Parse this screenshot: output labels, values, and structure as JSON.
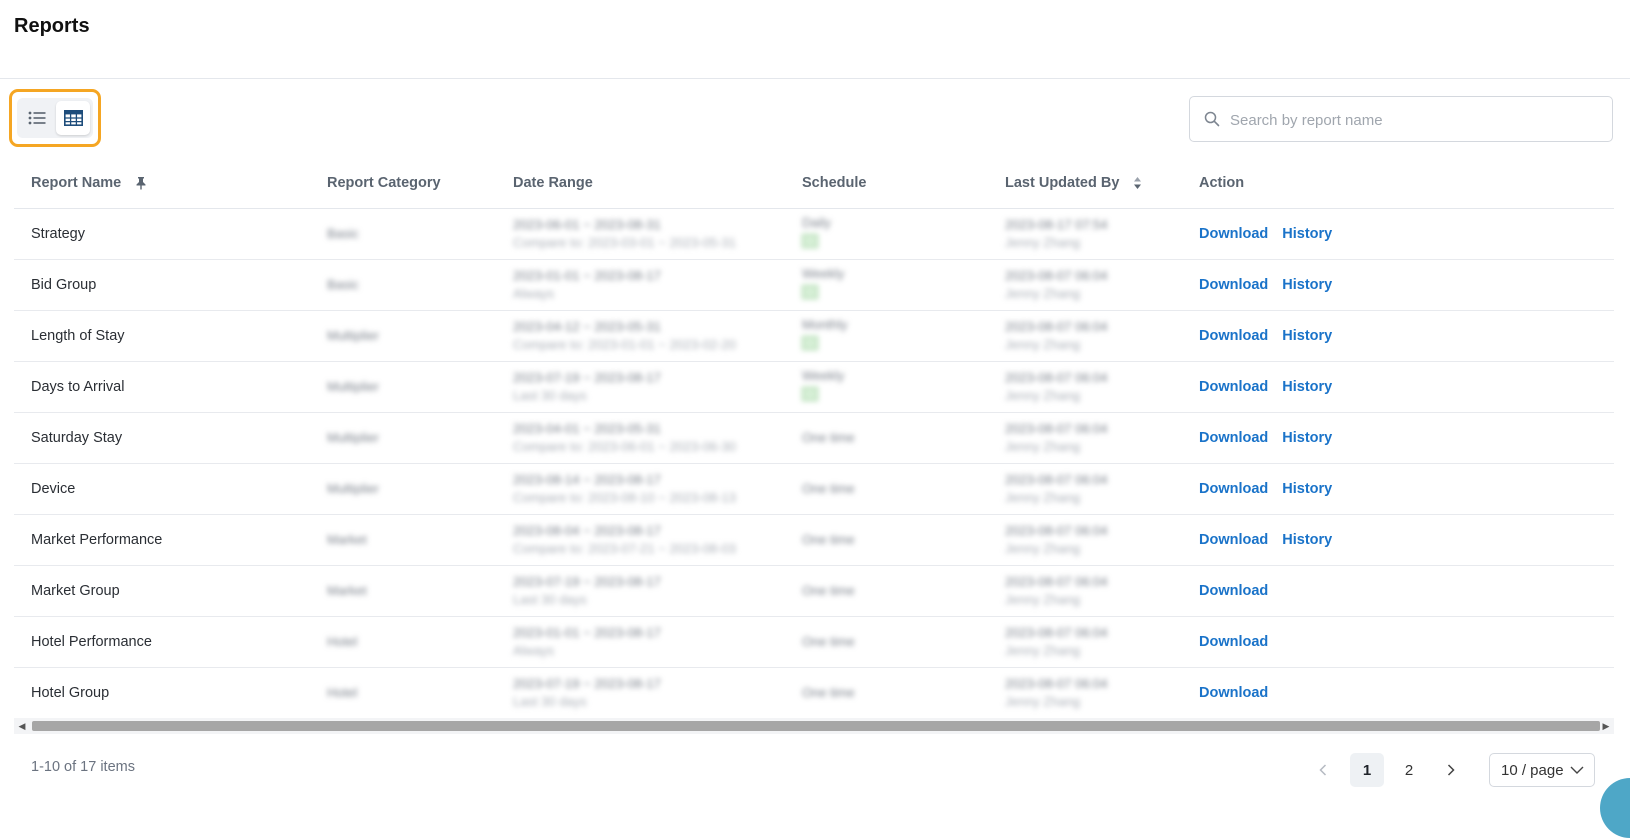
{
  "page": {
    "title": "Reports"
  },
  "view_toggle": {
    "list_icon": "list-icon",
    "table_icon": "table-icon",
    "active": "table"
  },
  "search": {
    "placeholder": "Search by report name",
    "value": "",
    "icon": "search-icon"
  },
  "table": {
    "columns": [
      {
        "label": "Report Name",
        "icon": "pin-icon"
      },
      {
        "label": "Report Category"
      },
      {
        "label": "Date Range"
      },
      {
        "label": "Schedule"
      },
      {
        "label": "Last Updated By",
        "icon": "sort-icon"
      },
      {
        "label": "Action"
      }
    ],
    "rows": [
      {
        "name": "Strategy",
        "category": "Basic",
        "date": "2023-06-01 ~ 2023-08-31",
        "date_sub": "Compare to: 2023-03-01 ~ 2023-05-31",
        "schedule": "Daily",
        "schedule_icon": true,
        "updated": "2023-08-17 07:54",
        "updated_by": "Jenny Zhang",
        "actions": [
          "Download",
          "History"
        ]
      },
      {
        "name": "Bid Group",
        "category": "Basic",
        "date": "2023-01-01 ~ 2023-08-17",
        "date_sub": "Always",
        "schedule": "Weekly",
        "schedule_icon": true,
        "updated": "2023-08-07 06:04",
        "updated_by": "Jenny Zhang",
        "actions": [
          "Download",
          "History"
        ]
      },
      {
        "name": "Length of Stay",
        "category": "Multiplier",
        "date": "2023-04-12 ~ 2023-05-31",
        "date_sub": "Compare to: 2023-01-01 ~ 2023-02-20",
        "schedule": "Monthly",
        "schedule_icon": true,
        "updated": "2023-08-07 06:04",
        "updated_by": "Jenny Zhang",
        "actions": [
          "Download",
          "History"
        ]
      },
      {
        "name": "Days to Arrival",
        "category": "Multiplier",
        "date": "2023-07-19 ~ 2023-08-17",
        "date_sub": "Last 30 days",
        "schedule": "Weekly",
        "schedule_icon": true,
        "updated": "2023-08-07 06:04",
        "updated_by": "Jenny Zhang",
        "actions": [
          "Download",
          "History"
        ]
      },
      {
        "name": "Saturday Stay",
        "category": "Multiplier",
        "date": "2023-04-01 ~ 2023-05-31",
        "date_sub": "Compare to: 2023-06-01 ~ 2023-06-30",
        "schedule": "One time",
        "schedule_icon": false,
        "updated": "2023-08-07 06:04",
        "updated_by": "Jenny Zhang",
        "actions": [
          "Download",
          "History"
        ]
      },
      {
        "name": "Device",
        "category": "Multiplier",
        "date": "2023-08-14 ~ 2023-08-17",
        "date_sub": "Compare to: 2023-08-10 ~ 2023-08-13",
        "schedule": "One time",
        "schedule_icon": false,
        "updated": "2023-08-07 06:04",
        "updated_by": "Jenny Zhang",
        "actions": [
          "Download",
          "History"
        ]
      },
      {
        "name": "Market Performance",
        "category": "Market",
        "date": "2023-08-04 ~ 2023-08-17",
        "date_sub": "Compare to: 2023-07-21 ~ 2023-08-03",
        "schedule": "One time",
        "schedule_icon": false,
        "updated": "2023-08-07 06:04",
        "updated_by": "Jenny Zhang",
        "actions": [
          "Download",
          "History"
        ]
      },
      {
        "name": "Market Group",
        "category": "Market",
        "date": "2023-07-19 ~ 2023-08-17",
        "date_sub": "Last 30 days",
        "schedule": "One time",
        "schedule_icon": false,
        "updated": "2023-08-07 06:04",
        "updated_by": "Jenny Zhang",
        "actions": [
          "Download"
        ]
      },
      {
        "name": "Hotel Performance",
        "category": "Hotel",
        "date": "2023-01-01 ~ 2023-08-17",
        "date_sub": "Always",
        "schedule": "One time",
        "schedule_icon": false,
        "updated": "2023-08-07 06:04",
        "updated_by": "Jenny Zhang",
        "actions": [
          "Download"
        ]
      },
      {
        "name": "Hotel Group",
        "category": "Hotel",
        "date": "2023-07-19 ~ 2023-08-17",
        "date_sub": "Last 30 days",
        "schedule": "One time",
        "schedule_icon": false,
        "updated": "2023-08-07 06:04",
        "updated_by": "Jenny Zhang",
        "actions": [
          "Download"
        ]
      }
    ]
  },
  "pagination": {
    "summary": "1-10 of 17 items",
    "pages": [
      "1",
      "2"
    ],
    "current": "1",
    "prev_icon": "chevron-left-icon",
    "next_icon": "chevron-right-icon",
    "page_size": "10 / page"
  },
  "colors": {
    "accent": "#1a73c9",
    "highlight": "#f5a623"
  }
}
